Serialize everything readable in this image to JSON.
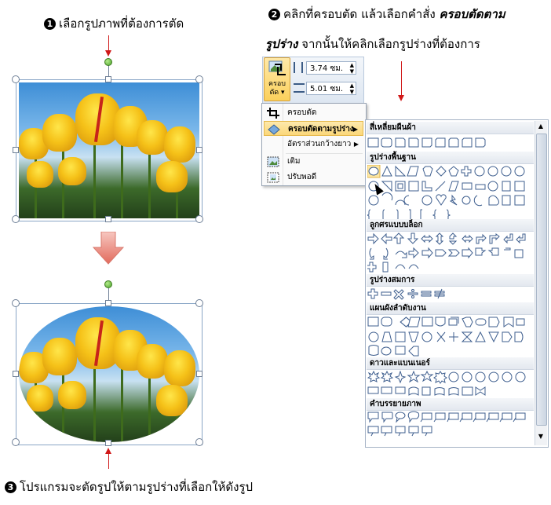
{
  "steps": {
    "step1": {
      "num": "1",
      "text": "เลือกรูปภาพที่ต้องการตัด"
    },
    "step2": {
      "num": "2",
      "line1_prefix": "คลิกที่ครอบตัด แล้วเลือกคำสั่ง ",
      "line1_em": "ครอบตัดตาม",
      "line2_em": "รูปร่าง",
      "line2_rest": " จากนั้นให้คลิกเลือกรูปร่างที่ต้องการ"
    },
    "step3": {
      "num": "3",
      "text": "โปรแกรมจะตัดรูปให้ตามรูปร่างที่เลือกให้ดังรูป"
    }
  },
  "ribbon": {
    "crop_label_line1": "ครอบ",
    "crop_label_line2": "ตัด",
    "height_value": "3.74 ซม.",
    "width_value": "5.01 ซม."
  },
  "crop_menu": {
    "items": [
      {
        "label": "ครอบตัด"
      },
      {
        "label": "ครอบตัดตามรูปร่าง"
      },
      {
        "label": "อัตราส่วนกว้างยาว"
      },
      {
        "label": "เติม"
      },
      {
        "label": "ปรับพอดี"
      }
    ]
  },
  "shape_gallery": {
    "sections": [
      {
        "title": "สี่เหลี่ยมผืนผ้า"
      },
      {
        "title": "รูปร่างพื้นฐาน"
      },
      {
        "title": "ลูกศรแบบบล็อก"
      },
      {
        "title": "รูปร่างสมการ"
      },
      {
        "title": "แผนผังลำดับงาน"
      },
      {
        "title": "ดาวและแบนเนอร์"
      },
      {
        "title": "คำบรรยายภาพ"
      }
    ]
  },
  "colors": {
    "accent_red": "#d01818",
    "selection_border": "#8aa6c6",
    "ribbon_highlight": "#fbd05c"
  }
}
